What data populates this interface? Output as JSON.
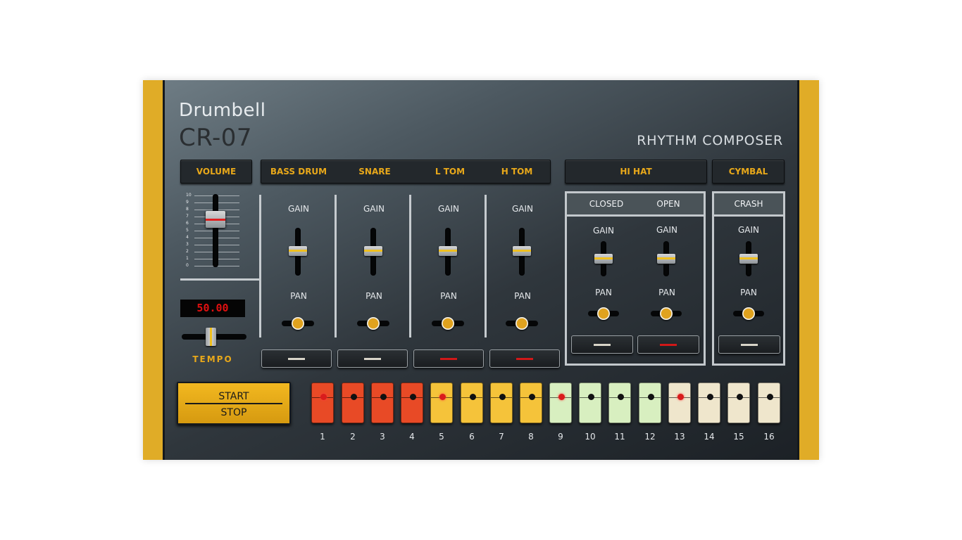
{
  "header": {
    "brand": "Drumbell",
    "model": "CR-07",
    "subtitle": "RHYTHM COMPOSER"
  },
  "sections": {
    "volume": "VOLUME",
    "bass_drum": "BASS DRUM",
    "snare": "SNARE",
    "l_tom": "L TOM",
    "h_tom": "H TOM",
    "hi_hat": "HI HAT",
    "cymbal": "CYMBAL"
  },
  "volume": {
    "scale": [
      "10",
      "9",
      "8",
      "7",
      "6",
      "5",
      "4",
      "3",
      "2",
      "1",
      "0"
    ],
    "level": 6.5
  },
  "tempo": {
    "display": "50.00",
    "label": "TEMPO",
    "position": 0.5
  },
  "labels": {
    "gain": "GAIN",
    "pan": "PAN",
    "closed": "CLOSED",
    "open": "OPEN",
    "crash": "CRASH"
  },
  "channels": [
    {
      "name": "BASS DRUM",
      "gain": 0.5,
      "pan": 0.5,
      "mute_led_color": "#d8d4c8"
    },
    {
      "name": "SNARE",
      "gain": 0.5,
      "pan": 0.5,
      "mute_led_color": "#d8d4c8"
    },
    {
      "name": "L TOM",
      "gain": 0.5,
      "pan": 0.5,
      "mute_led_color": "#d01818"
    },
    {
      "name": "H TOM",
      "gain": 0.5,
      "pan": 0.5,
      "mute_led_color": "#d01818"
    },
    {
      "name": "CLOSED",
      "gain": 0.5,
      "pan": 0.5,
      "mute_led_color": "#d8d4c8"
    },
    {
      "name": "OPEN",
      "gain": 0.5,
      "pan": 0.5,
      "mute_led_color": "#d01818"
    },
    {
      "name": "CRASH",
      "gain": 0.5,
      "pan": 0.5,
      "mute_led_color": "#d8d4c8"
    }
  ],
  "transport": {
    "start": "START",
    "stop": "STOP"
  },
  "steps": [
    {
      "num": "1",
      "color": "#e84a26",
      "active": true
    },
    {
      "num": "2",
      "color": "#e84a26",
      "active": false
    },
    {
      "num": "3",
      "color": "#e84a26",
      "active": false
    },
    {
      "num": "4",
      "color": "#e84a26",
      "active": false
    },
    {
      "num": "5",
      "color": "#f5c33a",
      "active": true
    },
    {
      "num": "6",
      "color": "#f5c33a",
      "active": false
    },
    {
      "num": "7",
      "color": "#f5c33a",
      "active": false
    },
    {
      "num": "8",
      "color": "#f5c33a",
      "active": false
    },
    {
      "num": "9",
      "color": "#d8efc0",
      "active": true
    },
    {
      "num": "10",
      "color": "#d8efc0",
      "active": false
    },
    {
      "num": "11",
      "color": "#d8efc0",
      "active": false
    },
    {
      "num": "12",
      "color": "#d8efc0",
      "active": false
    },
    {
      "num": "13",
      "color": "#efe6cc",
      "active": true
    },
    {
      "num": "14",
      "color": "#efe6cc",
      "active": false
    },
    {
      "num": "15",
      "color": "#efe6cc",
      "active": false
    },
    {
      "num": "16",
      "color": "#efe6cc",
      "active": false
    }
  ],
  "colors": {
    "accent": "#e0ac27",
    "label_orange": "#e8a81a",
    "display_red": "#e01010"
  }
}
